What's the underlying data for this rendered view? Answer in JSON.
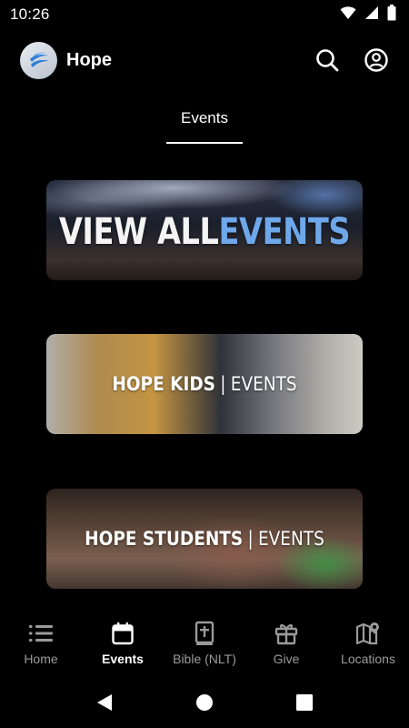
{
  "status_bar": {
    "time": "10:26",
    "icons": [
      "wifi-icon",
      "signal-icon",
      "battery-icon"
    ]
  },
  "app_bar": {
    "title": "Hope",
    "logo": "hope-logo",
    "actions": [
      "search-icon",
      "account-icon"
    ]
  },
  "tabs": [
    {
      "label": "Events",
      "selected": true
    }
  ],
  "cards": [
    {
      "title_part1": "VIEW ALL ",
      "title_part2": "EVENTS"
    },
    {
      "title_main": "HOPE KIDS",
      "separator": "|",
      "title_suffix": "EVENTS"
    },
    {
      "title_main": "HOPE STUDENTS",
      "separator": "|",
      "title_suffix": "EVENTS"
    }
  ],
  "bottom_nav": [
    {
      "label": "Home",
      "icon": "list-icon",
      "active": false
    },
    {
      "label": "Events",
      "icon": "calendar-icon",
      "active": true
    },
    {
      "label": "Bible (NLT)",
      "icon": "bible-icon",
      "active": false
    },
    {
      "label": "Give",
      "icon": "gift-icon",
      "active": false
    },
    {
      "label": "Locations",
      "icon": "map-pin-icon",
      "active": false
    }
  ],
  "system_nav": [
    "back-icon",
    "home-icon",
    "recents-icon"
  ],
  "colors": {
    "background": "#000000",
    "accent_blue": "#6fa8ea",
    "inactive_nav": "#9a9a9a"
  }
}
